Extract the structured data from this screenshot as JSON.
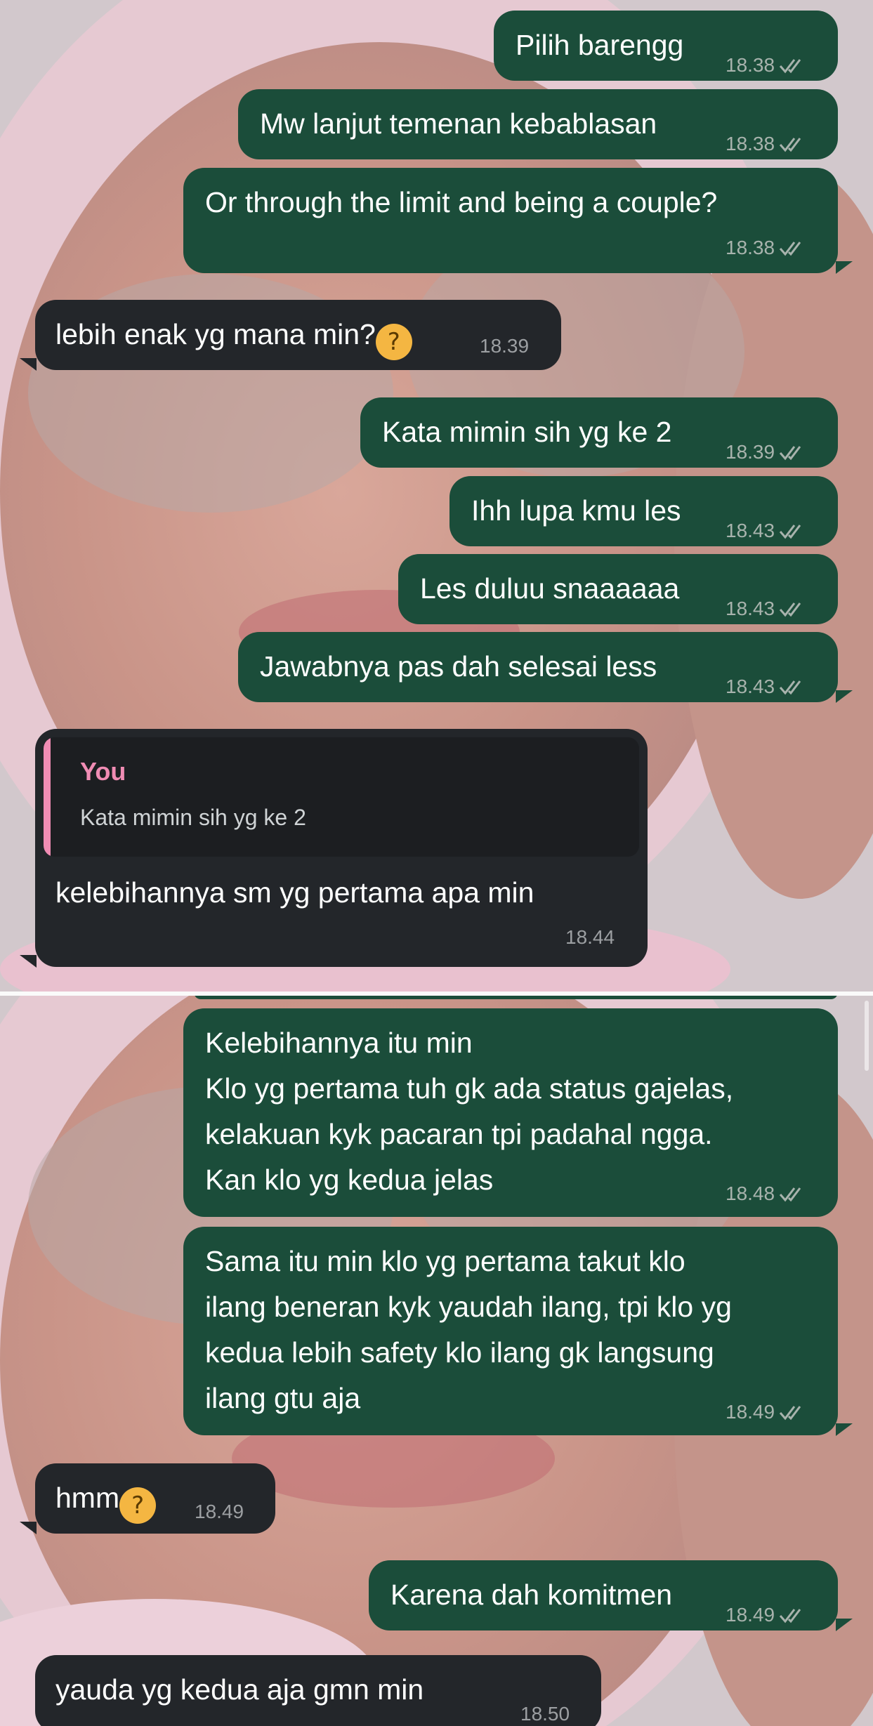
{
  "chat": {
    "top": [
      {
        "id": "m1",
        "dir": "out",
        "lines": [
          "Pilih barengg"
        ],
        "time": "18.38",
        "read": true
      },
      {
        "id": "m2",
        "dir": "out",
        "lines": [
          "Mw lanjut temenan kebablasan"
        ],
        "time": "18.38",
        "read": true
      },
      {
        "id": "m3",
        "dir": "out",
        "lines": [
          "Or through the limit and being a couple?"
        ],
        "time": "18.38",
        "read": true
      },
      {
        "id": "m4",
        "dir": "in",
        "lines": [
          "lebih enak yg mana min?"
        ],
        "emoji": "thinking-face",
        "time": "18.39"
      },
      {
        "id": "m5",
        "dir": "out",
        "lines": [
          "Kata mimin sih yg ke 2"
        ],
        "time": "18.39",
        "read": true
      },
      {
        "id": "m6",
        "dir": "out",
        "lines": [
          "Ihh lupa kmu les"
        ],
        "time": "18.43",
        "read": true
      },
      {
        "id": "m7",
        "dir": "out",
        "lines": [
          "Les duluu snaaaaaa"
        ],
        "time": "18.43",
        "read": true
      },
      {
        "id": "m8",
        "dir": "out",
        "lines": [
          "Jawabnya pas dah selesai less"
        ],
        "time": "18.43",
        "read": true
      },
      {
        "id": "m9",
        "dir": "in",
        "reply": {
          "author": "You",
          "text": "Kata mimin sih yg ke 2"
        },
        "lines": [
          "kelebihannya sm yg pertama apa min"
        ],
        "time": "18.44"
      }
    ],
    "bottom": [
      {
        "id": "m10",
        "dir": "out",
        "lines": [
          "Kelebihannya itu min",
          "Klo yg pertama tuh gk ada status gajelas,",
          "kelakuan kyk pacaran tpi padahal ngga.",
          "Kan klo yg kedua jelas"
        ],
        "time": "18.48",
        "read": true
      },
      {
        "id": "m11",
        "dir": "out",
        "lines": [
          "Sama itu min klo yg pertama takut klo",
          "ilang beneran kyk yaudah ilang, tpi klo yg",
          "kedua lebih safety klo ilang gk langsung",
          "ilang gtu aja"
        ],
        "time": "18.49",
        "read": true
      },
      {
        "id": "m12",
        "dir": "in",
        "lines": [
          "hmm"
        ],
        "emoji": "thinking-face",
        "time": "18.49"
      },
      {
        "id": "m13",
        "dir": "out",
        "lines": [
          "Karena dah komitmen"
        ],
        "time": "18.49",
        "read": true
      },
      {
        "id": "m14",
        "dir": "in",
        "lines": [
          "yauda yg kedua aja gmn min"
        ],
        "time": "18.50"
      }
    ]
  },
  "colors": {
    "outgoing_bubble": "#1b4d3a",
    "incoming_bubble": "#23262a",
    "reply_accent": "#f08cb4",
    "meta_text": "#a8b3ad"
  },
  "icons": {
    "read_receipt": "double-check-icon",
    "emoji": "thinking-face-emoji"
  }
}
